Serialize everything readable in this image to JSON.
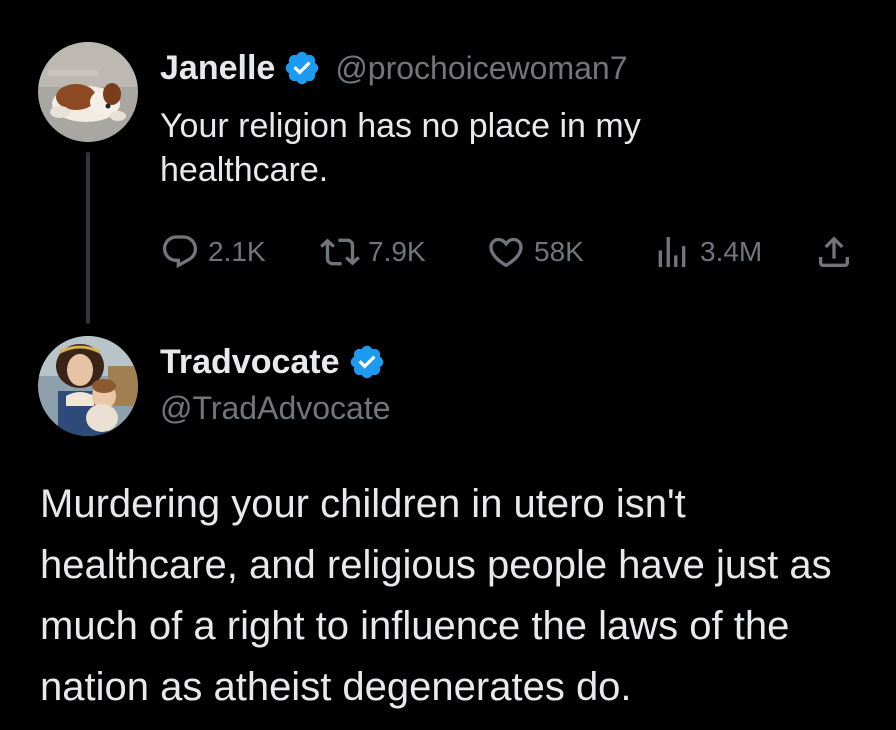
{
  "tweet1": {
    "display_name": "Janelle",
    "handle": "@prochoicewoman7",
    "text": "Your religion has no place in my healthcare.",
    "actions": {
      "replies": "2.1K",
      "retweets": "7.9K",
      "likes": "58K",
      "views": "3.4M"
    },
    "avatar_icon": "dog-avatar-icon"
  },
  "tweet2": {
    "display_name": "Tradvocate",
    "handle": "@TradAdvocate",
    "text": "Murdering your children in utero isn't healthcare, and religious people have just as much of a right to influence the laws of the nation as atheist degenerates do.",
    "avatar_icon": "mother-child-painting-avatar-icon"
  },
  "colors": {
    "background": "#000000",
    "text": "#e7e9ea",
    "secondary": "#71767b",
    "verified": "#1d9bf0"
  }
}
